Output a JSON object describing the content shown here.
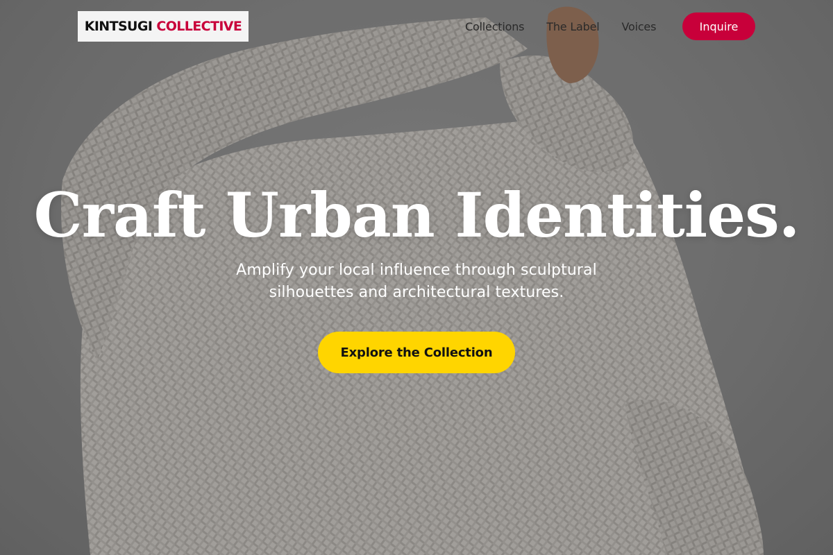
{
  "brand": {
    "name_part1": "KINTSUGI",
    "name_part2": "COLLECTIVE",
    "accent_color": "#c8003a"
  },
  "nav": {
    "items": [
      {
        "label": "Collections"
      },
      {
        "label": "The Label"
      },
      {
        "label": "Voices"
      }
    ],
    "inquire_label": "Inquire"
  },
  "hero": {
    "headline": "Craft Urban Identities.",
    "subheadline": "Amplify your local influence through sculptural silhouettes and architectural textures.",
    "cta_label": "Explore the Collection",
    "cta_color": "#ffd500",
    "background_image": "person-in-white-knit-sweater-photo"
  }
}
